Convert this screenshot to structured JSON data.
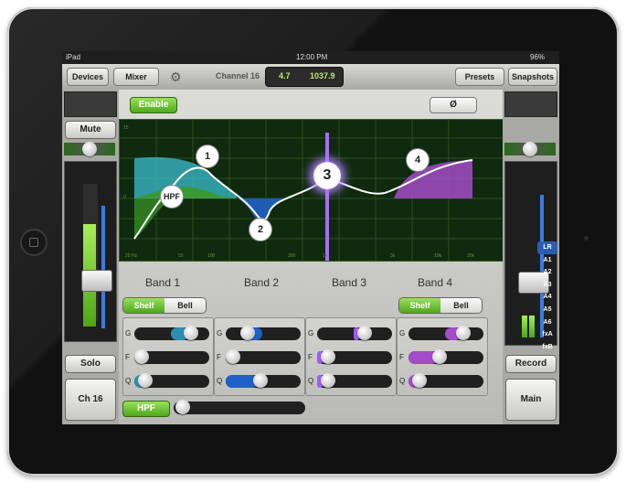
{
  "status": {
    "device": "iPad",
    "time": "12:00 PM",
    "battery": "96%"
  },
  "nav": {
    "devices": "Devices",
    "mixer": "Mixer",
    "channel_title": "Channel 16",
    "lcd_left": "4.7",
    "lcd_right": "1037.9",
    "presets": "Presets",
    "snapshots": "Snapshots"
  },
  "left_strip": {
    "mute": "Mute",
    "solo": "Solo",
    "channel_name": "Ch 16"
  },
  "right_strip": {
    "record": "Record",
    "main": "Main",
    "routes": [
      "LR",
      "A1",
      "A2",
      "A3",
      "A4",
      "A5",
      "A6",
      "fxA",
      "fxB"
    ]
  },
  "eq": {
    "enable": "Enable",
    "phase": "Ø",
    "hpf_node": "HPF",
    "nodes": [
      "1",
      "2",
      "3",
      "4"
    ],
    "bands": [
      "Band 1",
      "Band 2",
      "Band 3",
      "Band 4"
    ],
    "shelf": "Shelf",
    "bell": "Bell",
    "g": "G",
    "f": "F",
    "q": "Q",
    "hpf_button": "HPF",
    "freq_ticks": [
      "20 Hz",
      "50",
      "100",
      "300",
      "1k",
      "3k",
      "10k",
      "20k"
    ],
    "gain_ticks": [
      "15",
      "10",
      "5",
      "0",
      "5",
      "10",
      "15"
    ]
  },
  "colors": {
    "band1": "#3bbfd0",
    "band2": "#2060c8",
    "band3": "#9b5cff",
    "band4": "#a34cc8",
    "accent": "#7ec63a"
  }
}
